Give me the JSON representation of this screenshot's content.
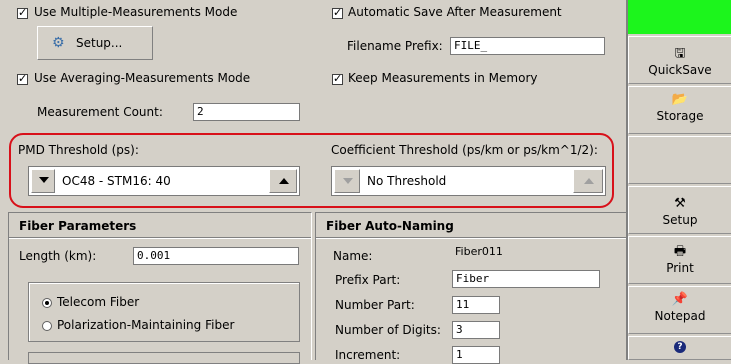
{
  "measurement": {
    "multi_mode_label": "Use Multiple-Measurements Mode",
    "setup_button": "Setup...",
    "averaging_label": "Use Averaging-Measurements Mode",
    "count_label": "Measurement Count:",
    "count_value": "2",
    "auto_save_label": "Automatic Save After Measurement",
    "prefix_label": "Filename Prefix:",
    "prefix_value": "FILE_",
    "keep_label": "Keep Measurements in Memory"
  },
  "thresholds": {
    "pmd_label": "PMD Threshold (ps):",
    "pmd_value": "OC48 - STM16: 40",
    "coef_label": "Coefficient Threshold (ps/km or ps/km^1/2):",
    "coef_value": "No Threshold"
  },
  "fiber_params": {
    "title": "Fiber Parameters",
    "length_label": "Length (km):",
    "length_value": "0.001",
    "telecom_label": "Telecom Fiber",
    "pm_label": "Polarization-Maintaining Fiber"
  },
  "auto_naming": {
    "title": "Fiber Auto-Naming",
    "name_label": "Name:",
    "name_value": "Fiber011",
    "prefix_label": "Prefix Part:",
    "prefix_value": "Fiber",
    "number_label": "Number Part:",
    "number_value": "11",
    "digits_label": "Number of Digits:",
    "digits_value": "3",
    "increment_label": "Increment:",
    "increment_value": "1"
  },
  "sidebar": {
    "quicksave": "QuickSave",
    "storage": "Storage",
    "setup": "Setup",
    "print": "Print",
    "notepad": "Notepad"
  },
  "colors": {
    "status_green": "#1cf51c",
    "highlight_red": "#d8101a"
  }
}
